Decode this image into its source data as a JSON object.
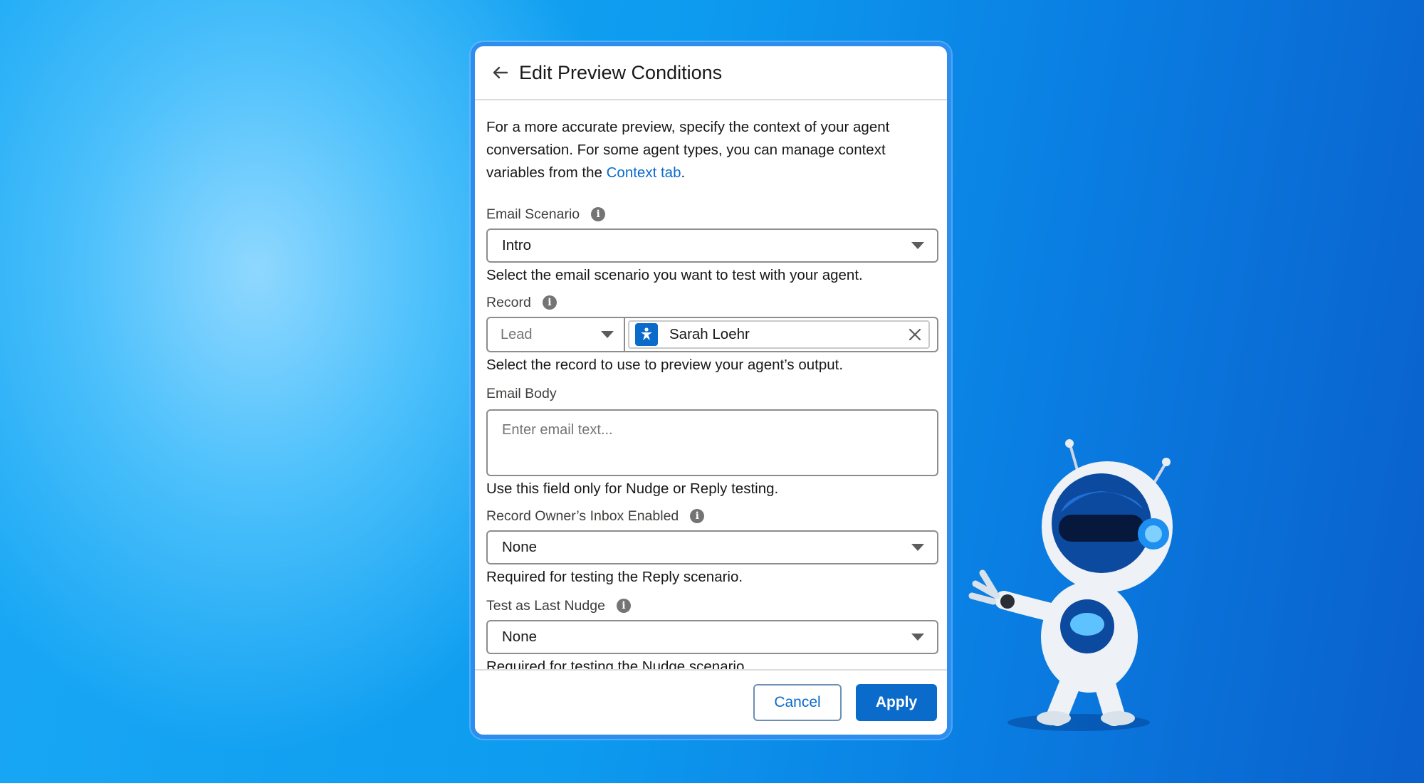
{
  "header": {
    "title": "Edit Preview Conditions",
    "back_icon": "arrow-left-icon"
  },
  "intro": {
    "text_before": "For a more accurate preview, specify the context of your agent conversation. For some agent types, you can manage context variables from the ",
    "link_text": "Context tab",
    "text_after": "."
  },
  "fields": {
    "email_scenario": {
      "label": "Email Scenario",
      "value": "Intro",
      "help": "Select the email scenario you want to test with your agent."
    },
    "record": {
      "label": "Record",
      "type_value": "Lead",
      "record_value": "Sarah Loehr",
      "help": "Select the record to use to preview your agent’s output."
    },
    "email_body": {
      "label": "Email Body",
      "placeholder": "Enter email text...",
      "help": "Use this field only for Nudge or Reply testing."
    },
    "inbox_enabled": {
      "label": "Record Owner’s Inbox Enabled",
      "value": "None",
      "help": "Required for testing the Reply scenario."
    },
    "last_nudge": {
      "label": "Test as Last Nudge",
      "value": "None",
      "help": "Required for testing the Nudge scenario."
    }
  },
  "footer": {
    "cancel_label": "Cancel",
    "apply_label": "Apply"
  },
  "colors": {
    "accent": "#0b6bcb",
    "panel_border": "#2d8ef0",
    "background": "#0d9bef"
  }
}
